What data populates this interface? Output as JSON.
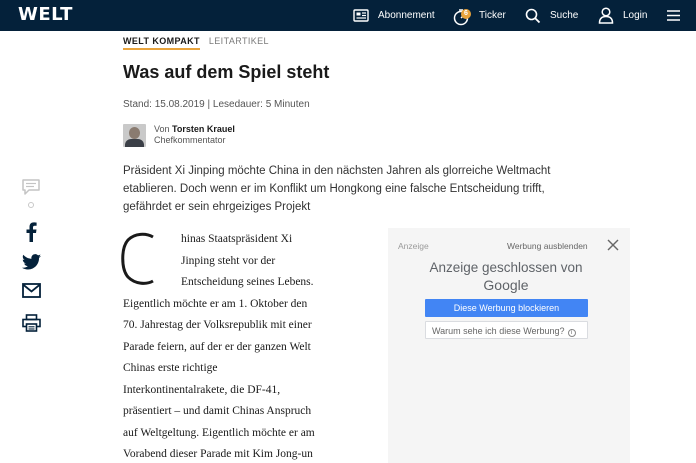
{
  "header": {
    "logo": "WELT",
    "abo_label": "Abonnement",
    "ticker_label": "Ticker",
    "ticker_badge": "6",
    "search_label": "Suche",
    "login_label": "Login",
    "background_color": "#04213a",
    "accent_color": "#e8a33c"
  },
  "article": {
    "kicker_primary": "WELT KOMPAKT",
    "kicker_secondary": "LEITARTIKEL",
    "headline": "Was auf dem Spiel steht",
    "meta": "Stand: 15.08.2019 | Lesedauer: 5 Minuten",
    "author_prefix": "Von",
    "author_name": "Torsten Krauel",
    "author_role": "Chefkommentator",
    "intro": "Präsident Xi Jinping möchte China in den nächsten Jahren als glorreiche Weltmacht etablieren. Doch wenn er im Konflikt um Hongkong eine falsche Entscheidung trifft, gefährdet er sein ehrgeiziges Projekt",
    "dropcap": "C",
    "body_lines": [
      "hinas Staatspräsident Xi",
      "Jinping steht vor der",
      "Entscheidung seines Lebens.",
      "Eigentlich möchte er am 1. Oktober den",
      "70. Jahrestag der Volksrepublik mit einer",
      "Parade feiern, auf der er der ganzen Welt",
      "Chinas erste richtige",
      "Interkontinentalrakete, die DF-41,",
      "präsentiert – und damit Chinas Anspruch",
      "auf Weltgeltung. Eigentlich möchte er am",
      "Vorabend dieser Parade mit Kim Jong-un"
    ]
  },
  "share_rail": {
    "icons": [
      "comment-icon",
      "facebook-icon",
      "twitter-icon",
      "mail-icon",
      "print-icon"
    ]
  },
  "ad": {
    "label": "Anzeige",
    "hide_label": "Werbung ausblenden",
    "closed_text": "Anzeige geschlossen von",
    "closed_brand": "Google",
    "block_button": "Diese Werbung blockieren",
    "why_button": "Warum sehe ich diese Werbung?",
    "info_glyph": "i",
    "block_color": "#4285f4"
  }
}
